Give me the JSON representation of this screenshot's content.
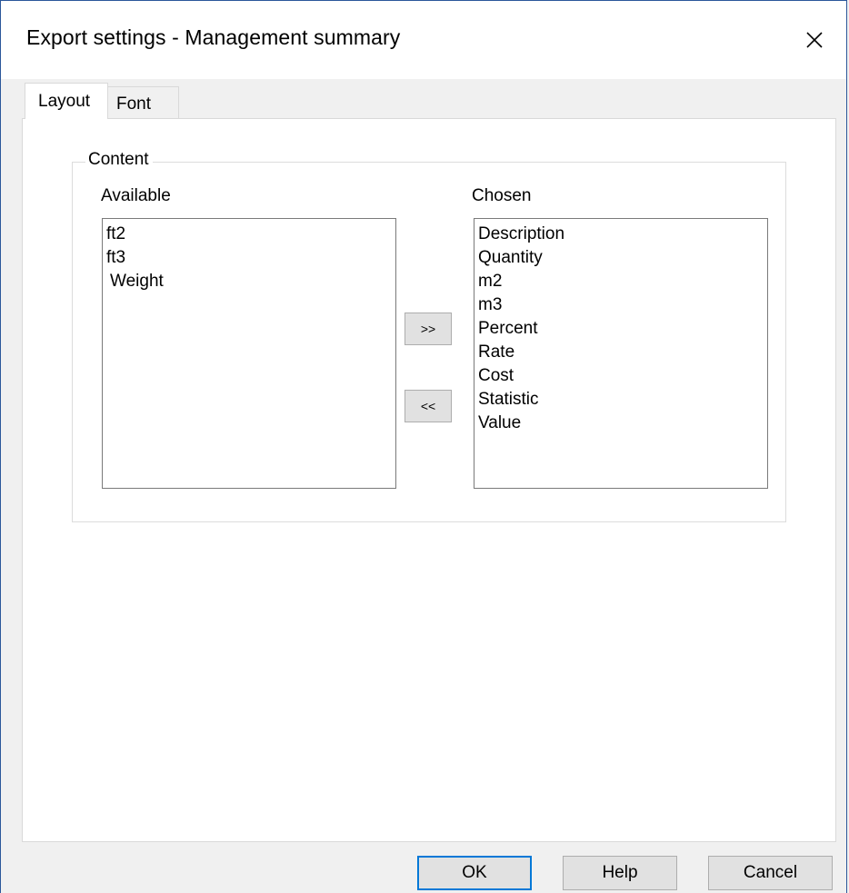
{
  "window": {
    "title": "Export settings - Management summary"
  },
  "tabs": [
    {
      "label": "Layout",
      "selected": true
    },
    {
      "label": "Font",
      "selected": false
    }
  ],
  "content_group": {
    "label": "Content",
    "available": {
      "label": "Available",
      "items": [
        "ft2",
        "ft3",
        "Weight"
      ]
    },
    "chosen": {
      "label": "Chosen",
      "items": [
        "Description",
        "Quantity",
        "m2",
        "m3",
        "Percent",
        "Rate",
        "Cost",
        "Statistic",
        "Value"
      ]
    },
    "add_label": ">>",
    "remove_label": "<<"
  },
  "footer": {
    "ok_label": "OK",
    "help_label": "Help",
    "cancel_label": "Cancel"
  },
  "icons": {
    "close": "close-icon"
  },
  "colors": {
    "focus_border": "#0078d7",
    "window_border": "#2b579a"
  }
}
